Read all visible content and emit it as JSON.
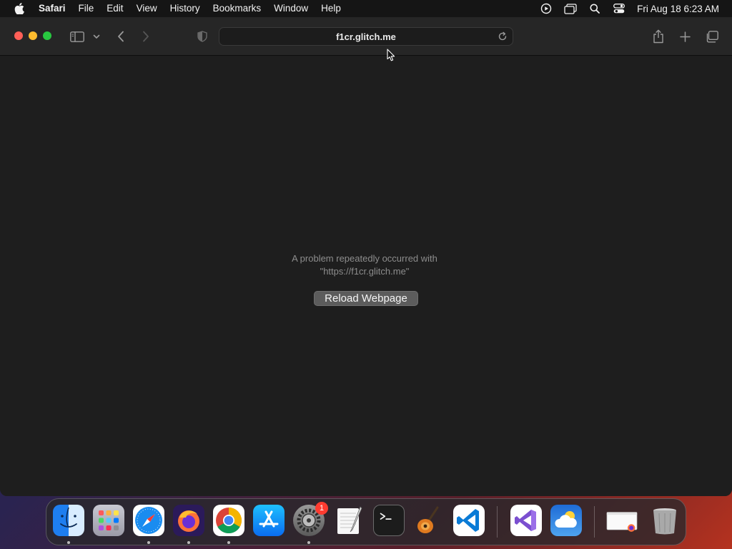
{
  "menubar": {
    "app_name": "Safari",
    "items": [
      "File",
      "Edit",
      "View",
      "History",
      "Bookmarks",
      "Window",
      "Help"
    ],
    "clock": "Fri Aug 18  6:23 AM"
  },
  "toolbar": {
    "url": "f1cr.glitch.me"
  },
  "error": {
    "line1": "A problem repeatedly occurred with",
    "line2": "\"https://f1cr.glitch.me\"",
    "reload_button": "Reload Webpage"
  },
  "dock": {
    "apps": [
      "Finder",
      "Launchpad",
      "Safari",
      "Firefox",
      "Chrome",
      "App Store",
      "System Settings",
      "TextEdit",
      "Terminal",
      "GarageBand",
      "Visual Studio Code",
      "Visual Studio",
      "Weather",
      "Downloads",
      "Trash"
    ],
    "system_settings_badge": "1"
  },
  "colors": {
    "close": "#ff5f57",
    "minimize": "#febc2e",
    "maximize": "#28c840",
    "badge": "#ff3b30"
  }
}
